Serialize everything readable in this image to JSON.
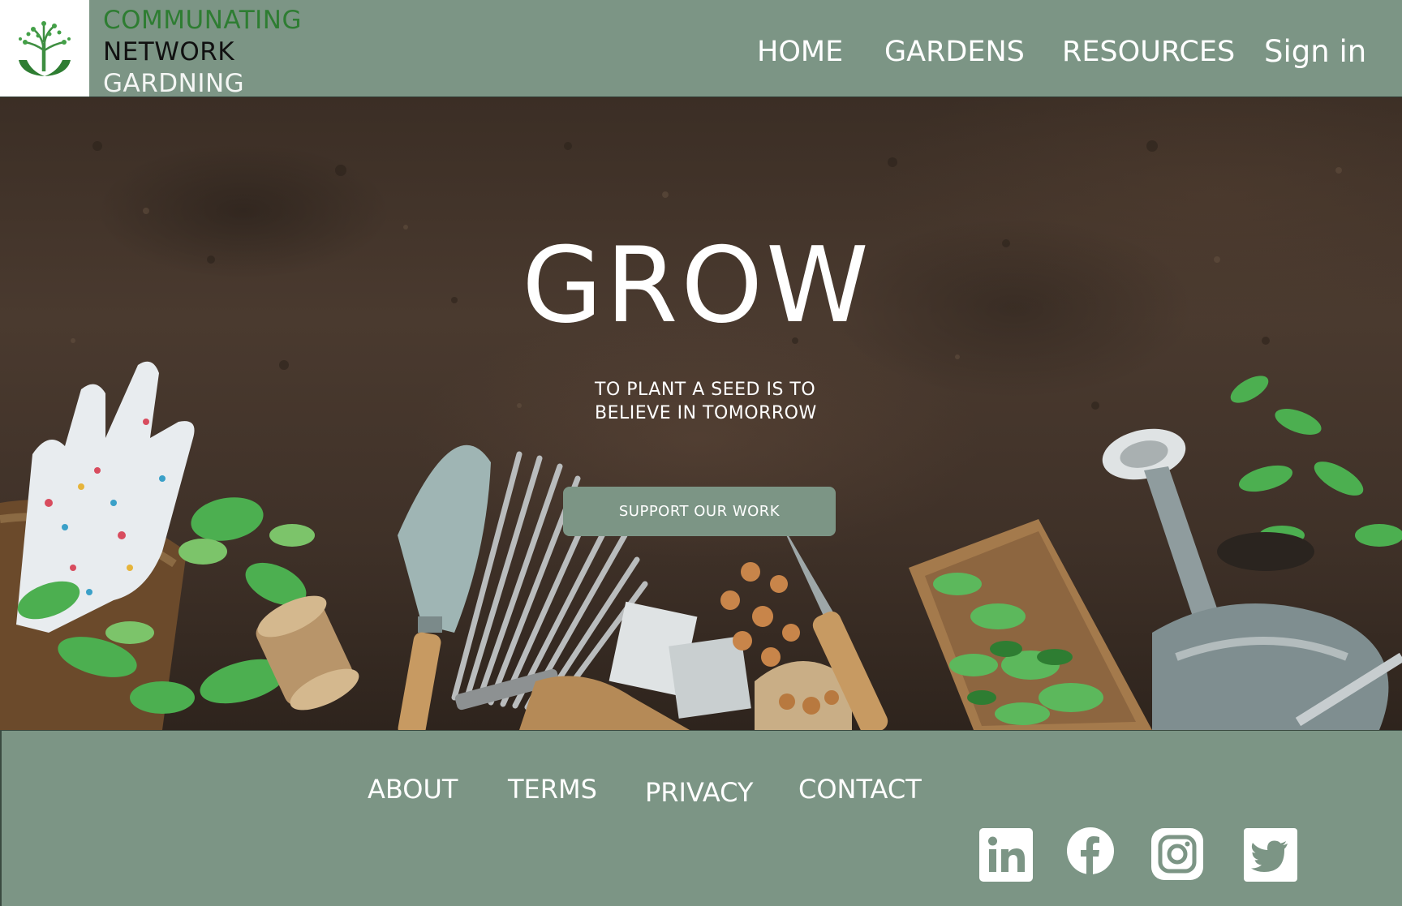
{
  "header": {
    "brand": {
      "line1": "COMMUNATING",
      "line2": "NETWORK",
      "line3": "GARDNING",
      "line1_color": "#2e7d32",
      "line2_color": "#111111"
    },
    "nav": {
      "home": "HOME",
      "gardens": "GARDENS",
      "resources": "RESOURCES",
      "signin": "Sign in"
    },
    "background_color": "#7c9585"
  },
  "hero": {
    "title": "GROW",
    "subtitle_line1": "TO PLANT A SEED  IS TO",
    "subtitle_line2": "BELIEVE IN TOMORROW",
    "button_label": "SUPPORT OUR WORK",
    "image": "soil-with-gardening-tools"
  },
  "footer": {
    "links": {
      "about": "ABOUT",
      "terms": "TERMS",
      "privacy": "PRIVACY",
      "contact": "CONTACT"
    },
    "social_icons": [
      "linkedin-icon",
      "facebook-icon",
      "instagram-icon",
      "twitter-icon"
    ]
  }
}
